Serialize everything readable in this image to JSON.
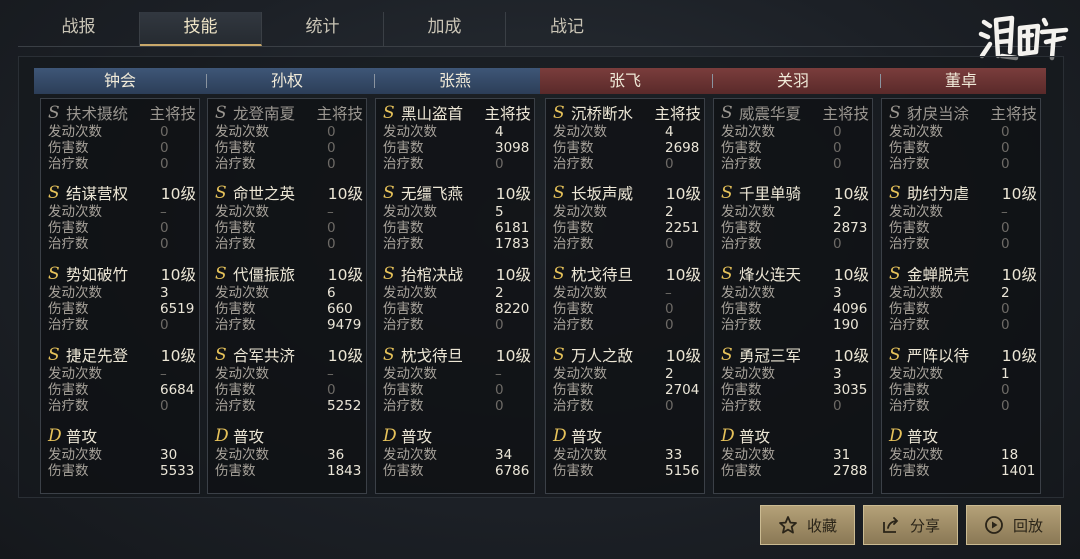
{
  "tabs": [
    {
      "label": "战报",
      "active": false
    },
    {
      "label": "技能",
      "active": true
    },
    {
      "label": "统计",
      "active": false
    },
    {
      "label": "加成",
      "active": false
    },
    {
      "label": "战记",
      "active": false
    }
  ],
  "logo_text": "鸿图之下",
  "labels": {
    "activations": "发动次数",
    "damage": "伤害数",
    "heal": "治疗数"
  },
  "heroes": [
    {
      "name": "钟会",
      "side": "blue",
      "skills": [
        {
          "grade": "S",
          "name": "扶术摄统",
          "level": "主将技",
          "dim": true,
          "stats": [
            "0",
            "0",
            "0"
          ]
        },
        {
          "grade": "S",
          "name": "结谋营权",
          "level": "10级",
          "dim": false,
          "stats": [
            "–",
            "0",
            "0"
          ]
        },
        {
          "grade": "S",
          "name": "势如破竹",
          "level": "10级",
          "dim": false,
          "stats": [
            "3",
            "6519",
            "0"
          ]
        },
        {
          "grade": "S",
          "name": "捷足先登",
          "level": "10级",
          "dim": false,
          "stats": [
            "–",
            "6684",
            "0"
          ]
        },
        {
          "grade": "D",
          "name": "普攻",
          "level": "",
          "dim": false,
          "stats": [
            "30",
            "5533"
          ]
        }
      ]
    },
    {
      "name": "孙权",
      "side": "blue",
      "skills": [
        {
          "grade": "S",
          "name": "龙登南夏",
          "level": "主将技",
          "dim": true,
          "stats": [
            "0",
            "0",
            "0"
          ]
        },
        {
          "grade": "S",
          "name": "命世之英",
          "level": "10级",
          "dim": false,
          "stats": [
            "–",
            "0",
            "0"
          ]
        },
        {
          "grade": "S",
          "name": "代僵振旅",
          "level": "10级",
          "dim": false,
          "stats": [
            "6",
            "660",
            "9479"
          ]
        },
        {
          "grade": "S",
          "name": "合军共济",
          "level": "10级",
          "dim": false,
          "stats": [
            "–",
            "0",
            "5252"
          ]
        },
        {
          "grade": "D",
          "name": "普攻",
          "level": "",
          "dim": false,
          "stats": [
            "36",
            "1843"
          ]
        }
      ]
    },
    {
      "name": "张燕",
      "side": "blue",
      "skills": [
        {
          "grade": "S",
          "name": "黑山盗首",
          "level": "主将技",
          "dim": false,
          "stats": [
            "4",
            "3098",
            "0"
          ]
        },
        {
          "grade": "S",
          "name": "无缰飞燕",
          "level": "10级",
          "dim": false,
          "stats": [
            "5",
            "6181",
            "1783"
          ]
        },
        {
          "grade": "S",
          "name": "抬棺决战",
          "level": "10级",
          "dim": false,
          "stats": [
            "2",
            "8220",
            "0"
          ]
        },
        {
          "grade": "S",
          "name": "枕戈待旦",
          "level": "10级",
          "dim": false,
          "stats": [
            "–",
            "0",
            "0"
          ]
        },
        {
          "grade": "D",
          "name": "普攻",
          "level": "",
          "dim": false,
          "stats": [
            "34",
            "6786"
          ]
        }
      ]
    },
    {
      "name": "张飞",
      "side": "red",
      "skills": [
        {
          "grade": "S",
          "name": "沉桥断水",
          "level": "主将技",
          "dim": false,
          "stats": [
            "4",
            "2698",
            "0"
          ]
        },
        {
          "grade": "S",
          "name": "长坂声威",
          "level": "10级",
          "dim": false,
          "stats": [
            "2",
            "2251",
            "0"
          ]
        },
        {
          "grade": "S",
          "name": "枕戈待旦",
          "level": "10级",
          "dim": false,
          "stats": [
            "–",
            "0",
            "0"
          ]
        },
        {
          "grade": "S",
          "name": "万人之敌",
          "level": "10级",
          "dim": false,
          "stats": [
            "2",
            "2704",
            "0"
          ]
        },
        {
          "grade": "D",
          "name": "普攻",
          "level": "",
          "dim": false,
          "stats": [
            "33",
            "5156"
          ]
        }
      ]
    },
    {
      "name": "关羽",
      "side": "red",
      "skills": [
        {
          "grade": "S",
          "name": "威震华夏",
          "level": "主将技",
          "dim": true,
          "stats": [
            "0",
            "0",
            "0"
          ]
        },
        {
          "grade": "S",
          "name": "千里单骑",
          "level": "10级",
          "dim": false,
          "stats": [
            "2",
            "2873",
            "0"
          ]
        },
        {
          "grade": "S",
          "name": "烽火连天",
          "level": "10级",
          "dim": false,
          "stats": [
            "3",
            "4096",
            "190"
          ]
        },
        {
          "grade": "S",
          "name": "勇冠三军",
          "level": "10级",
          "dim": false,
          "stats": [
            "3",
            "3035",
            "0"
          ]
        },
        {
          "grade": "D",
          "name": "普攻",
          "level": "",
          "dim": false,
          "stats": [
            "31",
            "2788"
          ]
        }
      ]
    },
    {
      "name": "董卓",
      "side": "red",
      "skills": [
        {
          "grade": "S",
          "name": "豺戾当涂",
          "level": "主将技",
          "dim": true,
          "stats": [
            "0",
            "0",
            "0"
          ]
        },
        {
          "grade": "S",
          "name": "助纣为虐",
          "level": "10级",
          "dim": false,
          "stats": [
            "–",
            "0",
            "0"
          ]
        },
        {
          "grade": "S",
          "name": "金蝉脱壳",
          "level": "10级",
          "dim": false,
          "stats": [
            "2",
            "0",
            "0"
          ]
        },
        {
          "grade": "S",
          "name": "严阵以待",
          "level": "10级",
          "dim": false,
          "stats": [
            "1",
            "0",
            "0"
          ]
        },
        {
          "grade": "D",
          "name": "普攻",
          "level": "",
          "dim": false,
          "stats": [
            "18",
            "1401"
          ]
        }
      ]
    }
  ],
  "buttons": {
    "favorite": "收藏",
    "share": "分享",
    "replay": "回放"
  }
}
